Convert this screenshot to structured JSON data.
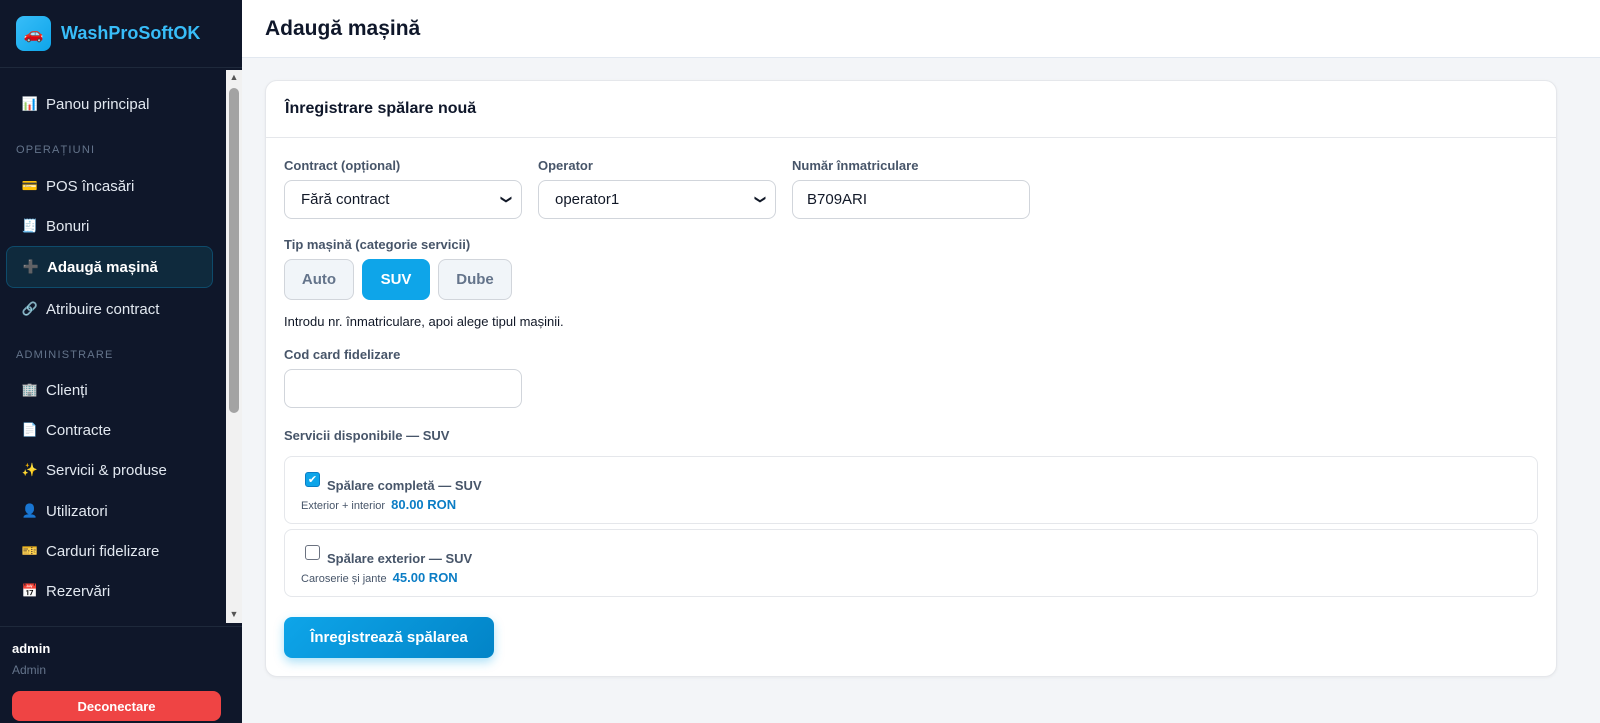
{
  "brand": {
    "name": "WashProSoftOK",
    "logo_icon": "car-icon"
  },
  "sidebar": {
    "items": [
      {
        "label": "Panou principal",
        "icon": "chart-icon",
        "glyph": "📊"
      },
      {
        "label": "POS încasări",
        "icon": "card-icon",
        "glyph": "💳"
      },
      {
        "label": "Bonuri",
        "icon": "receipt-icon",
        "glyph": "🧾"
      },
      {
        "label": "Adaugă mașină",
        "icon": "plus-icon",
        "glyph": "➕"
      },
      {
        "label": "Atribuire contract",
        "icon": "link-icon",
        "glyph": "🔗"
      },
      {
        "label": "Clienți",
        "icon": "building-icon",
        "glyph": "🏢"
      },
      {
        "label": "Contracte",
        "icon": "document-icon",
        "glyph": "📄"
      },
      {
        "label": "Servicii & produse",
        "icon": "sparkles-icon",
        "glyph": "✨"
      },
      {
        "label": "Utilizatori",
        "icon": "user-icon",
        "glyph": "👤"
      },
      {
        "label": "Carduri fidelizare",
        "icon": "ticket-icon",
        "glyph": "🎫"
      },
      {
        "label": "Rezervări",
        "icon": "calendar-icon",
        "glyph": "📅"
      }
    ],
    "sections": {
      "operations": "OPERAȚIUNI",
      "administration": "ADMINISTRARE"
    },
    "active_item": "Adaugă mașină"
  },
  "user": {
    "name": "admin",
    "role": "Admin",
    "logout_label": "Deconectare"
  },
  "page": {
    "title": "Adaugă mașină"
  },
  "form": {
    "card_title": "Înregistrare spălare nouă",
    "contract_label": "Contract (opțional)",
    "contract_value": "Fără contract",
    "operator_label": "Operator",
    "operator_value": "operator1",
    "plate_label": "Număr înmatriculare",
    "plate_value": "B709ARI",
    "type_label": "Tip mașină (categorie servicii)",
    "types": [
      "Auto",
      "SUV",
      "Dube"
    ],
    "selected_type": "SUV",
    "hint": "Introdu nr. înmatriculare, apoi alege tipul mașinii.",
    "loyalty_label": "Cod card fidelizare",
    "loyalty_value": "",
    "services_label": "Servicii disponibile — SUV",
    "services": [
      {
        "name": "Spălare completă — SUV",
        "desc": "Exterior + interior",
        "price": "80.00 RON",
        "checked": true
      },
      {
        "name": "Spălare exterior — SUV",
        "desc": "Caroserie și jante",
        "price": "45.00 RON",
        "checked": false
      }
    ],
    "submit_label": "Înregistrează spălarea"
  },
  "colors": {
    "accent": "#0ea5e9",
    "sidebar_bg": "#0f172a",
    "danger": "#ef4444",
    "brand_text": "#38bdf8"
  }
}
